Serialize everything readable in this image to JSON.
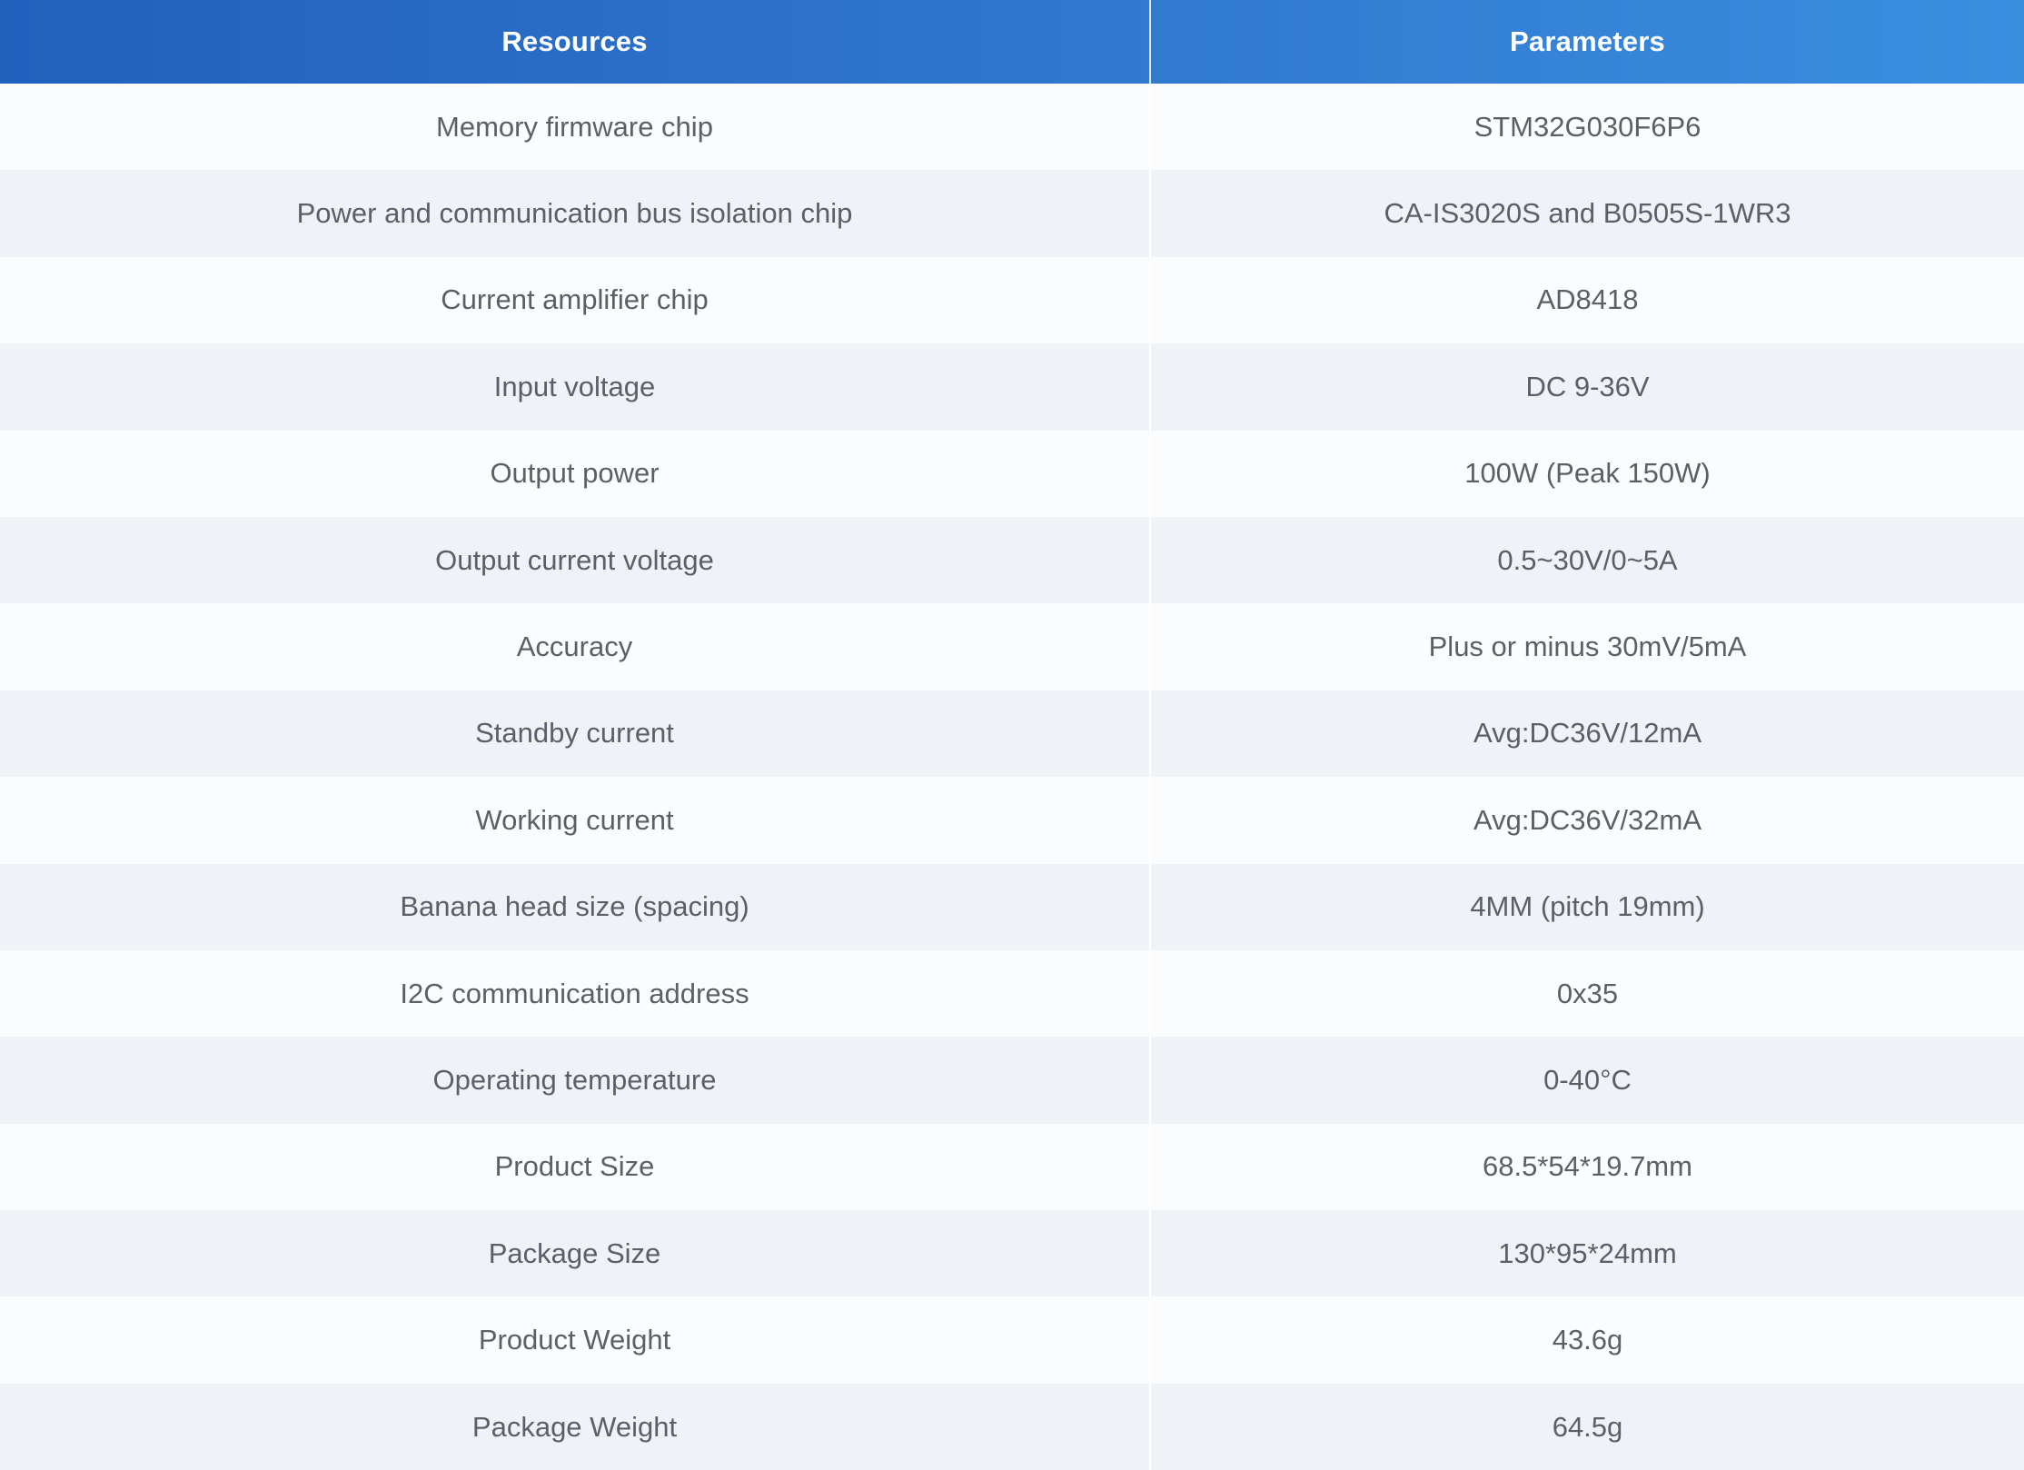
{
  "table": {
    "headers": {
      "resources": "Resources",
      "parameters": "Parameters"
    },
    "rows": [
      {
        "resource": "Memory firmware chip",
        "parameter": "STM32G030F6P6"
      },
      {
        "resource": "Power and communication bus isolation chip",
        "parameter": "CA-IS3020S and B0505S-1WR3"
      },
      {
        "resource": "Current amplifier chip",
        "parameter": "AD8418"
      },
      {
        "resource": "Input voltage",
        "parameter": "DC 9-36V"
      },
      {
        "resource": "Output power",
        "parameter": "100W (Peak 150W)"
      },
      {
        "resource": "Output current voltage",
        "parameter": "0.5~30V/0~5A"
      },
      {
        "resource": "Accuracy",
        "parameter": "Plus or minus 30mV/5mA"
      },
      {
        "resource": "Standby current",
        "parameter": "Avg:DC36V/12mA"
      },
      {
        "resource": "Working current",
        "parameter": "Avg:DC36V/32mA"
      },
      {
        "resource": "Banana head size (spacing)",
        "parameter": "4MM (pitch 19mm)"
      },
      {
        "resource": "I2C communication address",
        "parameter": "0x35"
      },
      {
        "resource": "Operating temperature",
        "parameter": "0-40°C"
      },
      {
        "resource": "Product Size",
        "parameter": "68.5*54*19.7mm"
      },
      {
        "resource": "Package Size",
        "parameter": "130*95*24mm"
      },
      {
        "resource": "Product Weight",
        "parameter": "43.6g"
      },
      {
        "resource": "Package Weight",
        "parameter": "64.5g"
      }
    ]
  },
  "colors": {
    "header_gradient_start": "#2160bd",
    "header_gradient_end": "#3a8ee0",
    "row_odd": "#fbfcfe",
    "row_even": "#eff3f8",
    "text": "#5c6066"
  }
}
